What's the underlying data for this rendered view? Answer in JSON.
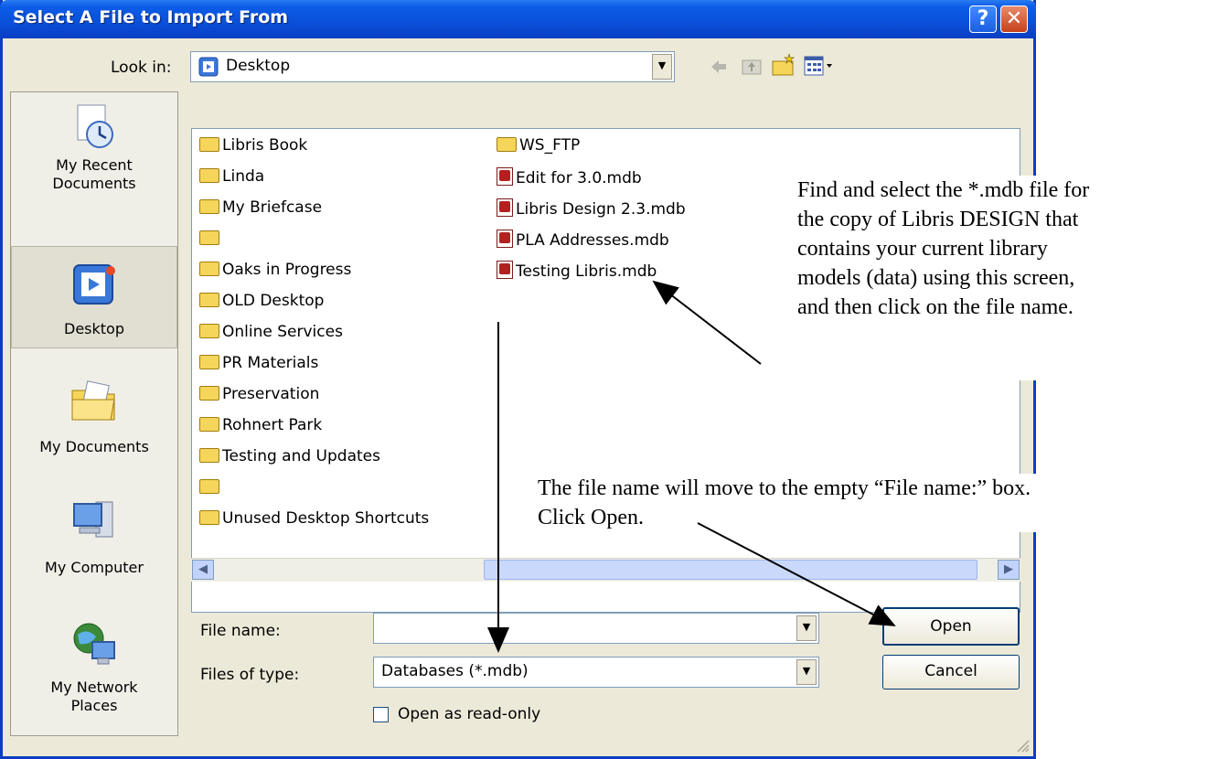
{
  "dialog": {
    "title": "Select A File to Import From",
    "help_label": "?",
    "close_label": "✕"
  },
  "lookin": {
    "label": "Look in:",
    "value": "Desktop"
  },
  "places": [
    {
      "label": "My Recent Documents",
      "icon": "recent-documents-icon"
    },
    {
      "label": "Desktop",
      "icon": "desktop-icon"
    },
    {
      "label": "My Documents",
      "icon": "my-documents-icon"
    },
    {
      "label": "My Computer",
      "icon": "my-computer-icon"
    },
    {
      "label": "My Network Places",
      "icon": "network-places-icon"
    }
  ],
  "files_col1": [
    {
      "name": "Libris Book",
      "type": "folder"
    },
    {
      "name": "Linda",
      "type": "folder"
    },
    {
      "name": "My Briefcase",
      "type": "folder"
    },
    {
      "name": "",
      "type": "folder"
    },
    {
      "name": "Oaks in Progress",
      "type": "folder"
    },
    {
      "name": "OLD Desktop",
      "type": "folder"
    },
    {
      "name": "Online Services",
      "type": "folder"
    },
    {
      "name": "PR Materials",
      "type": "folder"
    },
    {
      "name": "Preservation",
      "type": "folder"
    },
    {
      "name": "Rohnert Park",
      "type": "folder"
    },
    {
      "name": "Testing and Updates",
      "type": "folder"
    },
    {
      "name": "",
      "type": "folder"
    },
    {
      "name": "Unused Desktop Shortcuts",
      "type": "folder"
    }
  ],
  "files_col2": [
    {
      "name": "WS_FTP",
      "type": "folder"
    },
    {
      "name": "Edit for 3.0.mdb",
      "type": "mdb"
    },
    {
      "name": "Libris Design 2.3.mdb",
      "type": "mdb"
    },
    {
      "name": "PLA Addresses.mdb",
      "type": "mdb"
    },
    {
      "name": "Testing Libris.mdb",
      "type": "mdb"
    }
  ],
  "filename": {
    "label": "File name:",
    "value": ""
  },
  "filetype": {
    "label": "Files of type:",
    "value": "Databases (*.mdb)"
  },
  "readonly": {
    "label": "Open as read-only",
    "checked": false
  },
  "buttons": {
    "open": "Open",
    "cancel": "Cancel"
  },
  "annotations": {
    "note1": "Find and select the *.mdb file for the copy of Libris DESIGN that contains your current library models (data) using this screen, and then click on the file name.",
    "note2_line1": "The file name will move to the empty “File name:” box.",
    "note2_line2": "Click Open."
  },
  "colors": {
    "titlebar": "#0a4fd8",
    "dialog_bg": "#ece9d8",
    "list_bg": "#ffffff"
  }
}
